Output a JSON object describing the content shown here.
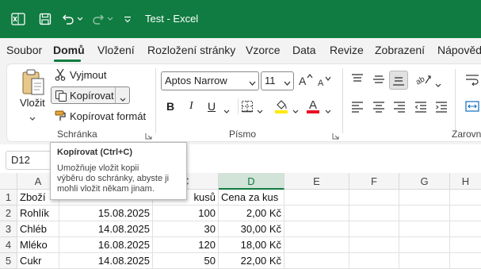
{
  "titlebar": {
    "title": "Test  -  Excel",
    "icons": [
      "excel-logo-icon",
      "save-icon",
      "undo-icon",
      "redo-icon",
      "customize-qat-icon"
    ],
    "bg_color": "#107c41"
  },
  "tabs": [
    "Soubor",
    "Domů",
    "Vložení",
    "Rozložení stránky",
    "Vzorce",
    "Data",
    "Revize",
    "Zobrazení",
    "Nápověda"
  ],
  "active_tab": "Domů",
  "ribbon": {
    "clipboard": {
      "paste_label": "Vložit",
      "cut_label": "Vyjmout",
      "copy_label": "Kopírovat",
      "format_painter_label": "Kopírovat formát",
      "group_label": "Schránka"
    },
    "font": {
      "font_name": "Aptos Narrow",
      "font_size": "11",
      "bold": "B",
      "italic": "I",
      "underline": "U",
      "font_color_letter": "A",
      "group_label": "Písmo"
    },
    "alignment": {
      "group_label": "Zarovna"
    }
  },
  "tooltip": {
    "title": "Kopírovat (Ctrl+C)",
    "lines": [
      "Umožňuje vložit kopii",
      "výběru do schránky, abyste ji",
      "mohli vložit někam jinam."
    ]
  },
  "formula_bar": {
    "name_box": "D12"
  },
  "sheet": {
    "columns": [
      "A",
      "B",
      "C",
      "D",
      "E",
      "F",
      "G",
      "H"
    ],
    "selected_column": "D",
    "rows": [
      {
        "num": "1",
        "cells": [
          "Zboží",
          "",
          "kusů",
          "Cena za kus"
        ]
      },
      {
        "num": "2",
        "cells": [
          "Rohlík",
          "15.08.2025",
          "100",
          "2,00 Kč"
        ]
      },
      {
        "num": "3",
        "cells": [
          "Chléb",
          "14.08.2025",
          "30",
          "30,00 Kč"
        ]
      },
      {
        "num": "4",
        "cells": [
          "Mléko",
          "16.08.2025",
          "120",
          "18,00 Kč"
        ]
      },
      {
        "num": "5",
        "cells": [
          "Cukr",
          "14.08.2025",
          "50",
          "22,00 Kč"
        ]
      }
    ]
  }
}
